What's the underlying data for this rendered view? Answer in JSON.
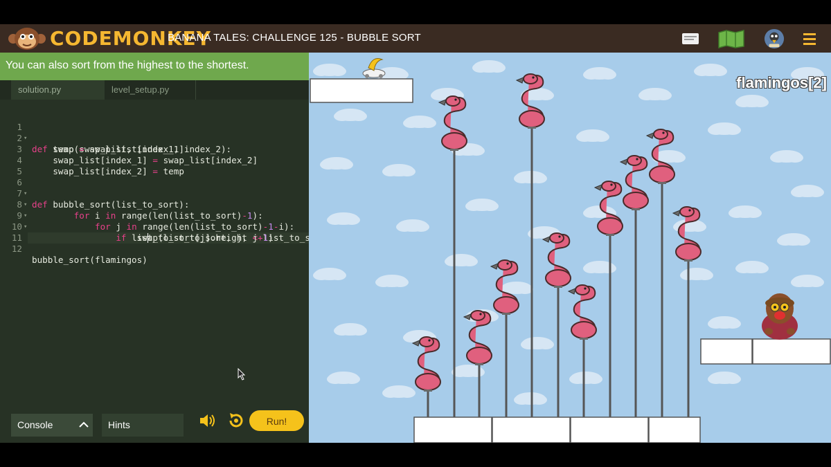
{
  "header": {
    "logo_text": "CODEMONKEY",
    "title": "BANANA TALES: CHALLENGE 125 - BUBBLE SORT",
    "icons": [
      "chat-icon",
      "map-icon",
      "avatar-icon",
      "menu-icon"
    ]
  },
  "instruction": "You can also sort from the highest to the shortest.",
  "editor": {
    "tabs": [
      "solution.py",
      "level_setup.py"
    ],
    "active_tab": "solution.py",
    "lines": [
      {
        "n": "1",
        "text": "def swap(swap_list, index_1, index_2):"
      },
      {
        "n": "2",
        "text": "    temp = swap_list[index_1]"
      },
      {
        "n": "3",
        "text": "    swap_list[index_1] = swap_list[index_2]"
      },
      {
        "n": "4",
        "text": "    swap_list[index_2] = temp"
      },
      {
        "n": "5",
        "text": ""
      },
      {
        "n": "6",
        "text": "def bubble_sort(list_to_sort):"
      },
      {
        "n": "7",
        "text": "        for i in range(len(list_to_sort)-1):"
      },
      {
        "n": "8",
        "text": "            for j in range(len(list_to_sort)-1-i):"
      },
      {
        "n": "9",
        "text": "                if list_to_sort[j].height < list_to_so"
      },
      {
        "n": "10",
        "text": "                    swap(list_to_sort, j, j+1)"
      },
      {
        "n": "11",
        "text": ""
      },
      {
        "n": "12",
        "text": "bubble_sort(flamingos)"
      }
    ]
  },
  "controls": {
    "console_label": "Console",
    "hints_label": "Hints",
    "run_label": "Run!"
  },
  "game": {
    "label": "flamingos[2]",
    "colors": {
      "sky": "#a7ccea",
      "flamingo": "#e0607e",
      "platform": "#ffffff"
    }
  }
}
